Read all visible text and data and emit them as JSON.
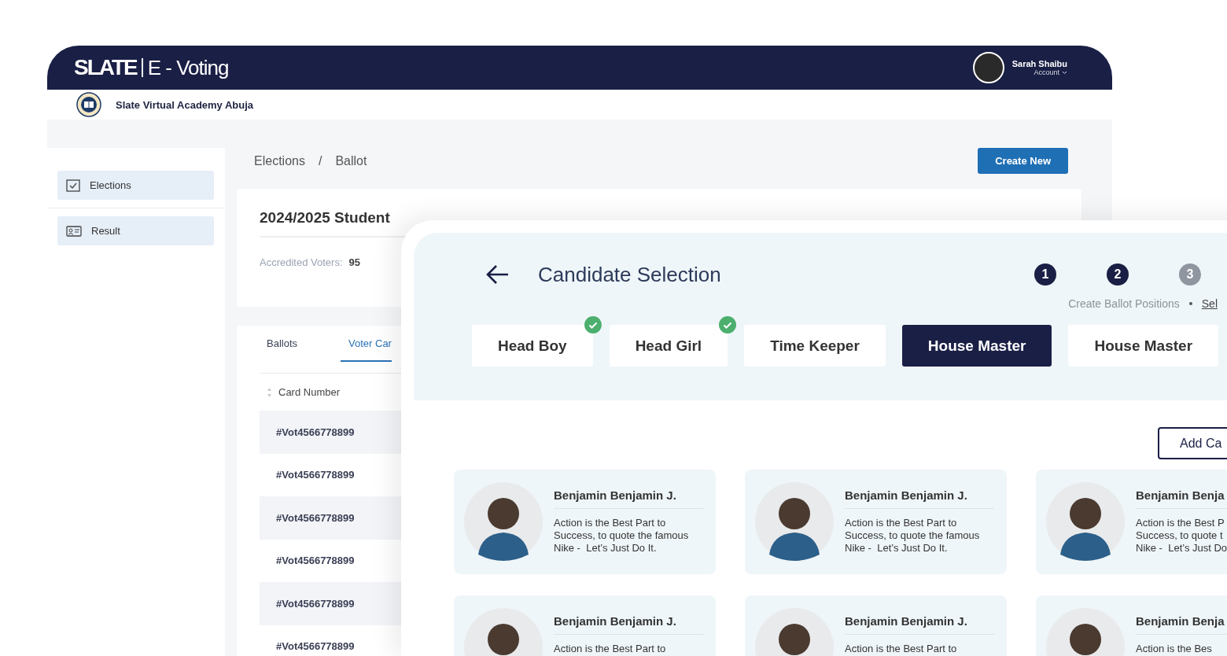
{
  "header": {
    "logo": "SLATE",
    "app_name": "E - Voting",
    "user": {
      "name": "Sarah Shaibu",
      "menu": "Account"
    }
  },
  "school": {
    "name": "Slate Virtual Academy Abuja"
  },
  "sidebar": {
    "items": [
      {
        "label": "Elections",
        "kind": "checklist"
      },
      {
        "label": "Result",
        "kind": "card"
      }
    ]
  },
  "breadcrumb": {
    "items": [
      "Elections",
      "Ballot"
    ],
    "separator": "/"
  },
  "create_button": "Create New",
  "election": {
    "title": "2024/2025 Student",
    "stats": [
      {
        "label": "Accredited Voters:",
        "value": "95"
      }
    ]
  },
  "tabs": [
    {
      "label": "Ballots",
      "selected": false
    },
    {
      "label": "Voter Car",
      "selected": true
    }
  ],
  "table": {
    "columns": [
      "Card Number"
    ],
    "rows": [
      {
        "card_number": "#Vot4566778899"
      },
      {
        "card_number": "#Vot4566778899"
      },
      {
        "card_number": "#Vot4566778899"
      },
      {
        "card_number": "#Vot4566778899"
      },
      {
        "card_number": "#Vot4566778899"
      },
      {
        "card_number": "#Vot4566778899"
      }
    ]
  },
  "selection_panel": {
    "title": "Candidate Selection",
    "steps": [
      {
        "number": "1",
        "active": true
      },
      {
        "number": "2",
        "active": true
      },
      {
        "number": "3",
        "active": false
      }
    ],
    "step_labels": [
      {
        "label": "Create Ballot Positions",
        "selected": false
      },
      {
        "label": "Sel",
        "selected": true
      }
    ],
    "positions": [
      {
        "label": "Head Boy",
        "done": true,
        "selected": false
      },
      {
        "label": "Head Girl",
        "done": true,
        "selected": false
      },
      {
        "label": "Time Keeper",
        "done": false,
        "selected": false
      },
      {
        "label": "House Master",
        "done": false,
        "selected": true
      },
      {
        "label": "House Master",
        "done": false,
        "selected": false
      }
    ],
    "add_button": "Add Ca",
    "candidates": [
      {
        "name": "Benjamin Benjamin J.",
        "motto": [
          "Action is the Best Part to",
          "Success, to quote the famous",
          "Nike -  Let’s Just Do It."
        ]
      },
      {
        "name": "Benjamin Benjamin J.",
        "motto": [
          "Action is the Best Part to",
          "Success, to quote the famous",
          "Nike -  Let’s Just Do It."
        ]
      },
      {
        "name": "Benjamin Benja",
        "motto": [
          "Action is the Best P",
          "Success, to quote t",
          "Nike -  Let’s Just Do"
        ]
      },
      {
        "name": "Benjamin Benjamin J.",
        "motto": [
          "Action is the Best Part to"
        ]
      },
      {
        "name": "Benjamin Benjamin J.",
        "motto": [
          "Action is the Best Part to"
        ]
      },
      {
        "name": "Benjamin Benja",
        "motto": [
          "Action is the Bes"
        ]
      }
    ]
  }
}
